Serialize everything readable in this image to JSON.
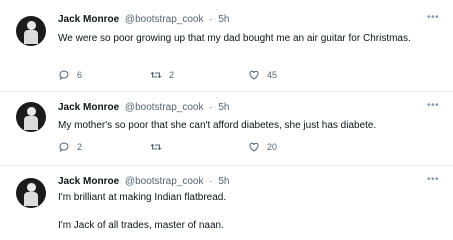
{
  "tweets": [
    {
      "name": "Jack Monroe",
      "handle": "@bootstrap_cook",
      "time": "5h",
      "text": "We were so poor growing up that my dad bought me an air guitar for Christmas.",
      "replies": "6",
      "retweets": "2",
      "likes": "45"
    },
    {
      "name": "Jack Monroe",
      "handle": "@bootstrap_cook",
      "time": "5h",
      "text": "My mother's so poor that she can't afford diabetes, she just has diabete.",
      "replies": "2",
      "retweets": "",
      "likes": "20"
    },
    {
      "name": "Jack Monroe",
      "handle": "@bootstrap_cook",
      "time": "5h",
      "text": "I'm brilliant at making Indian flatbread.",
      "text2": "I'm Jack of all trades, master of naan."
    }
  ],
  "separator": "·",
  "more_icon": "ellipsis-icon",
  "icons": {
    "reply": "reply-icon",
    "retweet": "retweet-icon",
    "like": "heart-icon"
  }
}
